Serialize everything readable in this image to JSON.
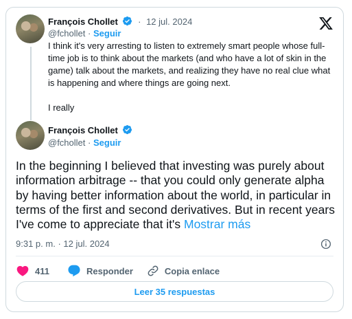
{
  "quoted_tweet": {
    "author_name": "François Chollet",
    "handle": "@fchollet",
    "follow_label": "Seguir",
    "date": "12 jul. 2024",
    "separator": "·",
    "text_p1": "I think it's very arresting to listen to extremely smart people whose full-time job is to think about the markets (and who have a lot of skin in the game) talk about the markets, and realizing they have no real clue what is happening and where things are going next.",
    "text_p2": "I really"
  },
  "main_tweet": {
    "author_name": "François Chollet",
    "handle": "@fchollet",
    "follow_label": "Seguir",
    "separator": "·",
    "text": "In the beginning I believed that investing was purely about information arbitrage -- that you could only generate alpha by having better information about the world, in particular in terms of the first and second derivatives. But in recent years I've come to appreciate that it's ",
    "show_more": "Mostrar más",
    "time": "9:31 p. m.",
    "date": "12 jul. 2024"
  },
  "actions": {
    "like_count": "411",
    "reply_label": "Responder",
    "copy_label": "Copia enlace"
  },
  "read_replies_label": "Leer 35 respuestas",
  "colors": {
    "accent": "#1d9bf0",
    "like": "#f91880",
    "muted": "#536471",
    "text": "#0f1419",
    "border": "#cfd9de"
  },
  "icons": [
    "verified-badge-icon",
    "x-logo-icon",
    "info-icon",
    "heart-icon",
    "reply-bubble-icon",
    "link-icon"
  ]
}
